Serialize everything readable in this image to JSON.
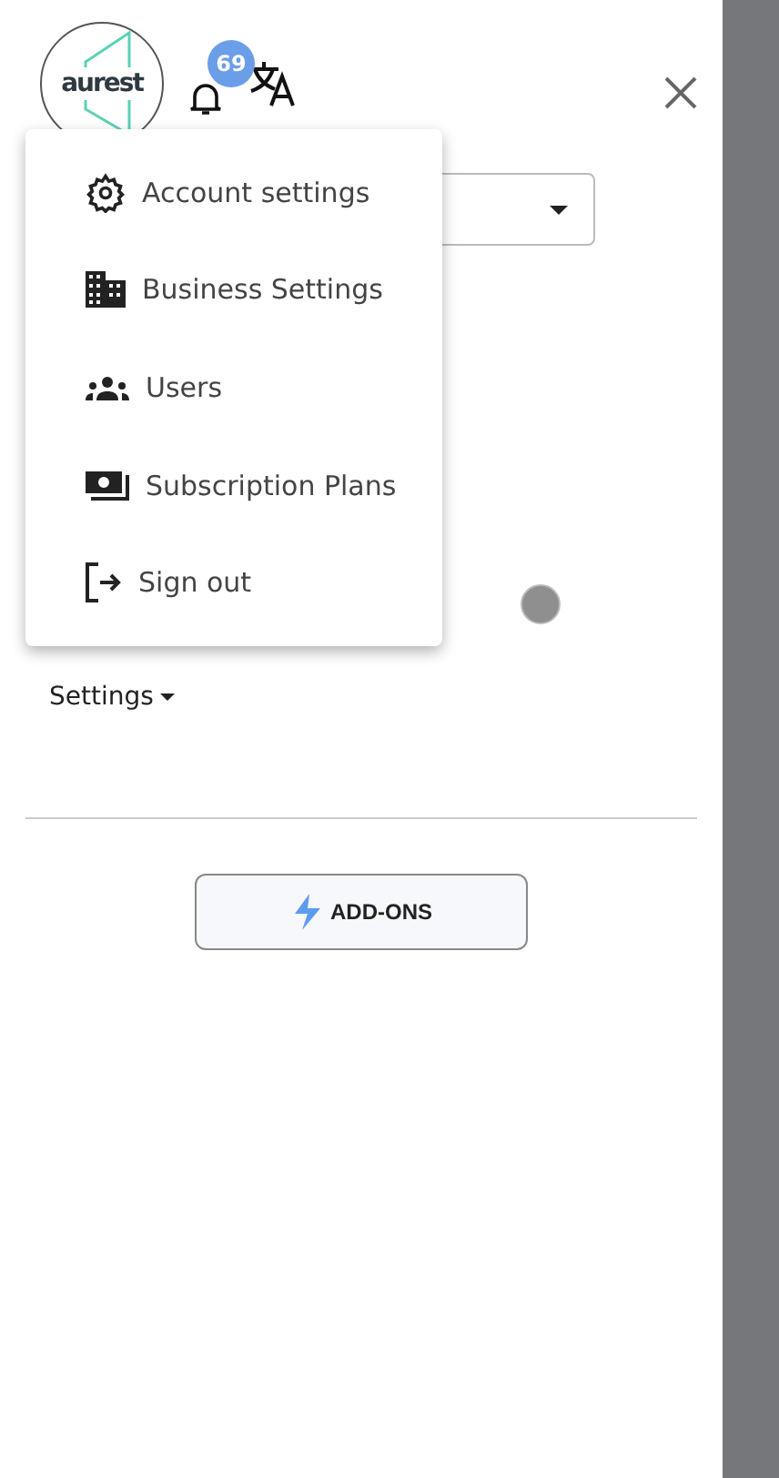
{
  "header": {
    "logo": "aurest",
    "notifications": {
      "count": "69"
    }
  },
  "account_menu": {
    "items": [
      {
        "label": "Account settings",
        "kind": "gear"
      },
      {
        "label": "Business Settings",
        "kind": "building"
      },
      {
        "label": "Users",
        "kind": "users"
      },
      {
        "label": "Subscription Plans",
        "kind": "money"
      },
      {
        "label": "Sign out",
        "kind": "logout"
      }
    ]
  },
  "settings_dropdown": {
    "label": "Settings"
  },
  "addons_button": {
    "label": "ADD-ONS"
  }
}
